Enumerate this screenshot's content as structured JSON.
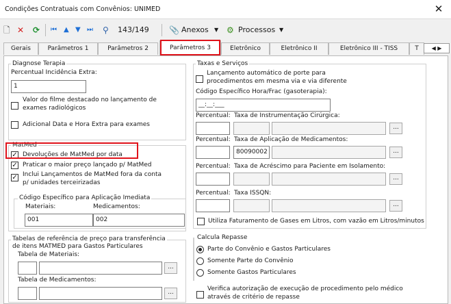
{
  "window": {
    "title": "Condições Contratuais com Convênios: UNIMED",
    "close_glyph": "✕"
  },
  "toolbar": {
    "record_counter": "143/149",
    "anexos_label": "Anexos",
    "processos_label": "Processos"
  },
  "tabs": [
    {
      "label": "Gerais"
    },
    {
      "label": "Parâmetros 1"
    },
    {
      "label": "Parâmetros 2"
    },
    {
      "label": "Parâmetros 3"
    },
    {
      "label": "Eletrônico"
    },
    {
      "label": "Eletrônico II"
    },
    {
      "label": "Eletrônico III - TISS"
    },
    {
      "label": "T"
    }
  ],
  "diagnose": {
    "group_title": "Diagnose Terapia",
    "percentual_label": "Percentual Incidência Extra:",
    "percentual_value": "1",
    "valor_filme_label1": "Valor do filme destacado no lançamento de",
    "valor_filme_label2": "exames radiológicos",
    "adicional_label": "Adicional Data e Hora Extra para exames"
  },
  "matmed": {
    "group_title": "MatMed",
    "devolucoes_label": "Devoluções de MatMed por data",
    "praticar_label": "Praticar o maior preço lançado p/ MatMed",
    "incluir_label1": "Inclui Lançamentos de MatMed fora da conta",
    "incluir_label2": "p/ unidades terceirizadas",
    "codigo_group_title": "Código Específico para Aplicação Imediata",
    "materiais_label": "Materiais:",
    "medicamentos_label": "Medicamentos:",
    "materiais_value": "001",
    "medicamentos_value": "002"
  },
  "tabelas": {
    "group_title1": "Tabelas de referência de preço para transferência",
    "group_title2": "de itens MATMED para Gastos Particulares",
    "materiais_label": "Tabela de Materiais:",
    "medicamentos_label": "Tabela de Medicamentos:"
  },
  "taxas": {
    "group_title": "Taxas e Serviços",
    "lancamento_label1": "Lançamento automático de porte para",
    "lancamento_label2": "procedimentos em mesma via e via diferente",
    "codigo_label": "Código Específico Hora/Frac (gasoterapia):",
    "codigo_value": "__:__:___",
    "percentual_label": "Percentual:",
    "taxa_instrumentacao_label": "Taxa de Instrumentação Cirúrgica:",
    "taxa_aplicacao_label": "Taxa de Aplicação de Medicamentos:",
    "taxa_aplicacao_value": "80090002",
    "taxa_acrescimo_label": "Taxa de Acréscimo para Paciente em Isolamento:",
    "taxa_issqn_label": "Taxa ISSQN:",
    "utiliza_label": "Utiliza Faturamento de Gases em Litros, com vazão em Litros/minutos"
  },
  "repasse": {
    "group_title": "Calcula Repasse",
    "options": [
      "Parte do Convênio e Gastos Particulares",
      "Somente Parte do Convênio",
      "Somente Gastos Particulares"
    ]
  },
  "verifica": {
    "label1": "Verifica autorização de execução de procedimento pelo médico",
    "label2": "através de critério de repasse"
  },
  "ellipsis": "...",
  "check_glyph": "✓",
  "colors": {
    "highlight": "#e0121a"
  }
}
